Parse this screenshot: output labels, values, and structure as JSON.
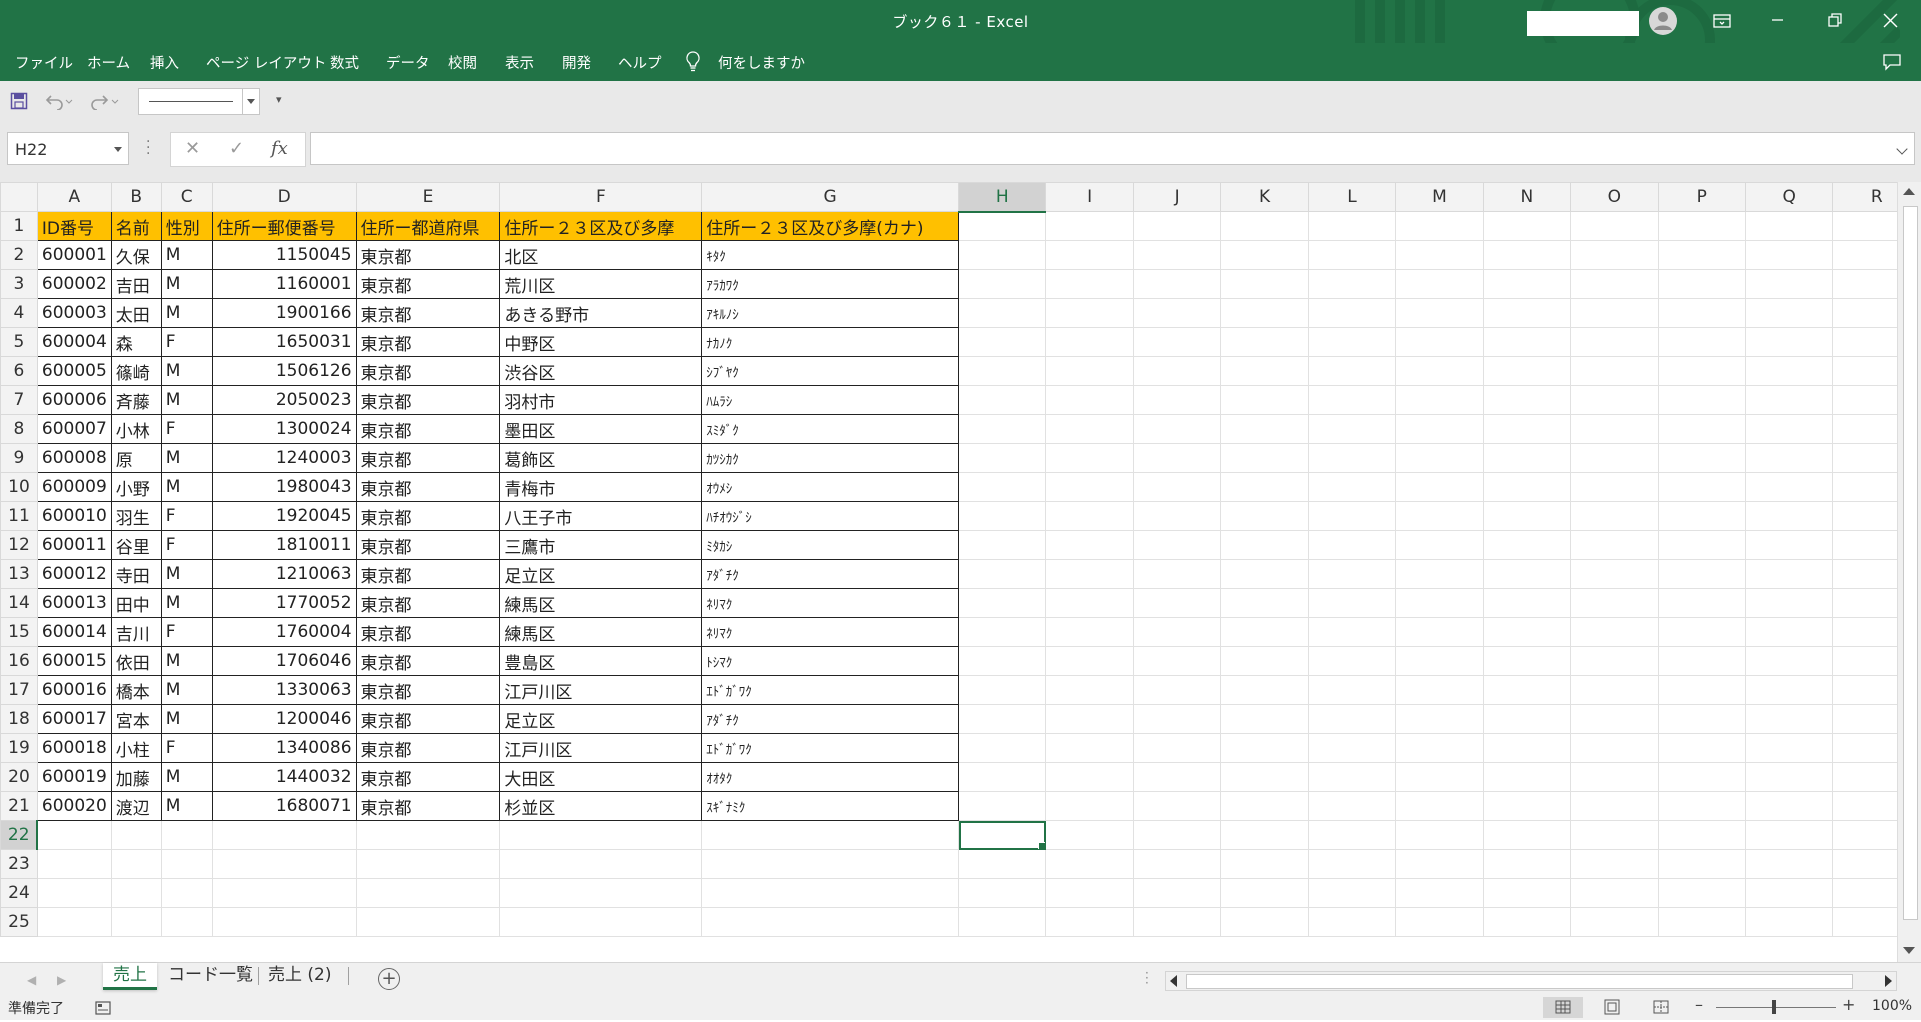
{
  "window": {
    "title": "ブック６１  -  Excel",
    "account_name": ""
  },
  "ribbon": {
    "tabs": [
      "ファイル",
      "ホーム",
      "挿入",
      "ページ レイアウト",
      "数式",
      "データ",
      "校閲",
      "表示",
      "開発",
      "ヘルプ"
    ],
    "tell_me": "何をしますか"
  },
  "formula_bar": {
    "name_box": "H22",
    "fx_label": "fx",
    "formula": ""
  },
  "sheet": {
    "columns": [
      "A",
      "B",
      "C",
      "D",
      "E",
      "F",
      "G",
      "H",
      "I",
      "J",
      "K",
      "L",
      "M",
      "N",
      "O",
      "P",
      "Q",
      "R"
    ],
    "active_column": "H",
    "active_row": 22,
    "row_numbers": [
      1,
      2,
      3,
      4,
      5,
      6,
      7,
      8,
      9,
      10,
      11,
      12,
      13,
      14,
      15,
      16,
      17,
      18,
      19,
      20,
      21,
      22,
      23,
      24,
      25
    ],
    "headers": [
      "ID番号",
      "名前",
      "性別",
      "住所ー郵便番号",
      "住所ー都道府県",
      "住所ー２３区及び多摩",
      "住所ー２３区及び多摩(カナ)"
    ],
    "rows": [
      [
        "600001",
        "久保",
        "M",
        "1150045",
        "東京都",
        "北区",
        "ｷﾀｸ"
      ],
      [
        "600002",
        "吉田",
        "M",
        "1160001",
        "東京都",
        "荒川区",
        "ｱﾗｶﾜｸ"
      ],
      [
        "600003",
        "太田",
        "M",
        "1900166",
        "東京都",
        "あきる野市",
        "ｱｷﾙﾉｼ"
      ],
      [
        "600004",
        "森",
        "F",
        "1650031",
        "東京都",
        "中野区",
        "ﾅｶﾉｸ"
      ],
      [
        "600005",
        "篠崎",
        "M",
        "1506126",
        "東京都",
        "渋谷区",
        "ｼﾌﾞﾔｸ"
      ],
      [
        "600006",
        "斉藤",
        "M",
        "2050023",
        "東京都",
        "羽村市",
        "ﾊﾑﾗｼ"
      ],
      [
        "600007",
        "小林",
        "F",
        "1300024",
        "東京都",
        "墨田区",
        "ｽﾐﾀﾞｸ"
      ],
      [
        "600008",
        "原",
        "M",
        "1240003",
        "東京都",
        "葛飾区",
        "ｶﾂｼｶｸ"
      ],
      [
        "600009",
        "小野",
        "M",
        "1980043",
        "東京都",
        "青梅市",
        "ｵｳﾒｼ"
      ],
      [
        "600010",
        "羽生",
        "F",
        "1920045",
        "東京都",
        "八王子市",
        "ﾊﾁｵｳｼﾞｼ"
      ],
      [
        "600011",
        "谷里",
        "F",
        "1810011",
        "東京都",
        "三鷹市",
        "ﾐﾀｶｼ"
      ],
      [
        "600012",
        "寺田",
        "M",
        "1210063",
        "東京都",
        "足立区",
        "ｱﾀﾞﾁｸ"
      ],
      [
        "600013",
        "田中",
        "M",
        "1770052",
        "東京都",
        "練馬区",
        "ﾈﾘﾏｸ"
      ],
      [
        "600014",
        "吉川",
        "F",
        "1760004",
        "東京都",
        "練馬区",
        "ﾈﾘﾏｸ"
      ],
      [
        "600015",
        "依田",
        "M",
        "1706046",
        "東京都",
        "豊島区",
        "ﾄｼﾏｸ"
      ],
      [
        "600016",
        "橋本",
        "M",
        "1330063",
        "東京都",
        "江戸川区",
        "ｴﾄﾞｶﾞﾜｸ"
      ],
      [
        "600017",
        "宮本",
        "M",
        "1200046",
        "東京都",
        "足立区",
        "ｱﾀﾞﾁｸ"
      ],
      [
        "600018",
        "小柱",
        "F",
        "1340086",
        "東京都",
        "江戸川区",
        "ｴﾄﾞｶﾞﾜｸ"
      ],
      [
        "600019",
        "加藤",
        "M",
        "1440032",
        "東京都",
        "大田区",
        "ｵｵﾀｸ"
      ],
      [
        "600020",
        "渡辺",
        "M",
        "1680071",
        "東京都",
        "杉並区",
        "ｽｷﾞﾅﾐｸ"
      ]
    ]
  },
  "sheet_tabs": {
    "tabs": [
      "売上",
      "コード一覧",
      "売上 (2)"
    ],
    "active_index": 0
  },
  "status": {
    "text": "準備完了",
    "zoom": "100%"
  },
  "colors": {
    "accent": "#217346",
    "header_fill": "#ffc000",
    "gridline": "#e1e1e1"
  },
  "icons": [
    "save-icon",
    "undo-icon",
    "redo-icon",
    "lightbulb-icon",
    "comment-icon",
    "user-icon",
    "ribbon-display-icon",
    "minimize-icon",
    "restore-icon",
    "close-icon",
    "cancel-icon",
    "enter-icon",
    "fx-icon",
    "add-sheet-icon",
    "macro-record-icon",
    "normal-view-icon",
    "page-layout-view-icon",
    "page-break-view-icon"
  ]
}
